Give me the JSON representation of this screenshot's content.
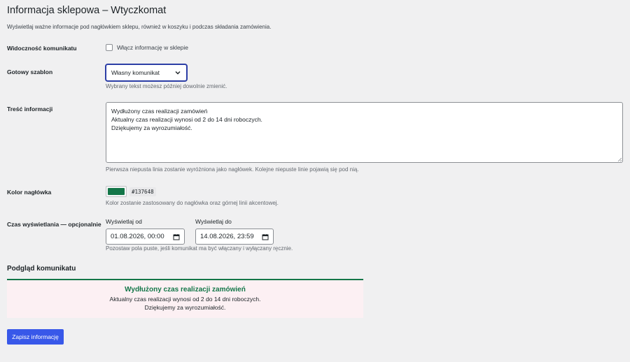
{
  "page": {
    "title": "Informacja sklepowa – Wtyczkomat",
    "intro": "Wyświetlaj ważne informacje pod nagłówkiem sklepu, również w koszyku i podczas składania zamówienia."
  },
  "visibility": {
    "label": "Widoczność komunikatu",
    "checkbox_label": "Włącz informację w sklepie",
    "checked": false
  },
  "template": {
    "label": "Gotowy szablon",
    "selected": "Własny komunikat",
    "description": "Wybrany tekst możesz później dowolnie zmienić."
  },
  "content": {
    "label": "Treść informacji",
    "lines": [
      "Wydłużony czas realizacji zamówień",
      "Aktualny czas realizacji wynosi od 2 do 14 dni roboczych.",
      "Dziękujemy za wyrozumiałość."
    ],
    "description": "Pierwsza niepusta linia zostanie wyróżniona jako nagłówek. Kolejne niepuste linie pojawią się pod nią."
  },
  "color": {
    "label": "Kolor nagłówka",
    "value": "#137648",
    "description": "Kolor zostanie zastosowany do nagłówka oraz górnej linii akcentowej."
  },
  "schedule": {
    "label": "Czas wyświetlania — opcjonalnie",
    "from_label": "Wyświetlaj od",
    "from_value": "01.08.2026, 00:00",
    "to_label": "Wyświetlaj do",
    "to_value": "14.08.2026, 23:59",
    "description": "Pozostaw pola puste, jeśli komunikat ma być włączany i wyłączany ręcznie."
  },
  "preview": {
    "title": "Podgląd komunikatu",
    "heading": "Wydłużony czas realizacji zamówień",
    "lines": [
      "Aktualny czas realizacji wynosi od 2 do 14 dni roboczych.",
      "Dziękujemy za wyrozumiałość."
    ],
    "accent_color": "#137648",
    "background_color": "#fcf0f3"
  },
  "actions": {
    "save_label": "Zapisz informację",
    "button_color": "#3858e9"
  }
}
